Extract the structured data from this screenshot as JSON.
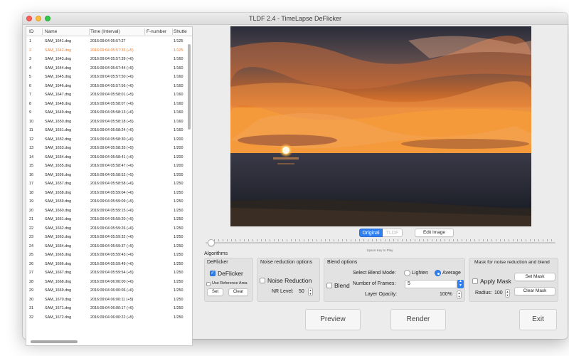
{
  "window": {
    "title": "TLDF 2.4 - TimeLapse DeFlicker"
  },
  "table": {
    "columns": [
      "ID",
      "Name",
      "Time (Interval)",
      "F-number",
      "Shutte"
    ],
    "rows": [
      {
        "id": "1",
        "name": "SAM_1641.dng",
        "time": "2016:09:04 05:57:27",
        "f": "",
        "shutter": "1/125"
      },
      {
        "id": "2",
        "name": "SAM_1642.dng",
        "time": "2016:09:04 05:57:33 (+5)",
        "f": "",
        "shutter": "1/125"
      },
      {
        "id": "3",
        "name": "SAM_1643.dng",
        "time": "2016:09:04 05:57:39 (+6)",
        "f": "",
        "shutter": "1/160"
      },
      {
        "id": "4",
        "name": "SAM_1644.dng",
        "time": "2016:09:04 05:57:44 (+5)",
        "f": "",
        "shutter": "1/160"
      },
      {
        "id": "5",
        "name": "SAM_1645.dng",
        "time": "2016:09:04 05:57:50 (+6)",
        "f": "",
        "shutter": "1/160"
      },
      {
        "id": "6",
        "name": "SAM_1646.dng",
        "time": "2016:09:04 05:57:56 (+6)",
        "f": "",
        "shutter": "1/160"
      },
      {
        "id": "7",
        "name": "SAM_1647.dng",
        "time": "2016:09:04 05:58:01 (+5)",
        "f": "",
        "shutter": "1/160"
      },
      {
        "id": "8",
        "name": "SAM_1648.dng",
        "time": "2016:09:04 05:58:07 (+6)",
        "f": "",
        "shutter": "1/160"
      },
      {
        "id": "9",
        "name": "SAM_1649.dng",
        "time": "2016:09:04 05:58:13 (+6)",
        "f": "",
        "shutter": "1/160"
      },
      {
        "id": "10",
        "name": "SAM_1650.dng",
        "time": "2016:09:04 05:58:18 (+5)",
        "f": "",
        "shutter": "1/160"
      },
      {
        "id": "11",
        "name": "SAM_1651.dng",
        "time": "2016:09:04 05:58:24 (+6)",
        "f": "",
        "shutter": "1/160"
      },
      {
        "id": "12",
        "name": "SAM_1652.dng",
        "time": "2016:09:04 05:58:30 (+6)",
        "f": "",
        "shutter": "1/200"
      },
      {
        "id": "13",
        "name": "SAM_1653.dng",
        "time": "2016:09:04 05:58:35 (+5)",
        "f": "",
        "shutter": "1/200"
      },
      {
        "id": "14",
        "name": "SAM_1654.dng",
        "time": "2016:09:04 05:58:41 (+6)",
        "f": "",
        "shutter": "1/200"
      },
      {
        "id": "15",
        "name": "SAM_1655.dng",
        "time": "2016:09:04 05:58:47 (+6)",
        "f": "",
        "shutter": "1/200"
      },
      {
        "id": "16",
        "name": "SAM_1656.dng",
        "time": "2016:09:04 05:58:52 (+5)",
        "f": "",
        "shutter": "1/200"
      },
      {
        "id": "17",
        "name": "SAM_1657.dng",
        "time": "2016:09:04 05:58:58 (+6)",
        "f": "",
        "shutter": "1/250"
      },
      {
        "id": "18",
        "name": "SAM_1658.dng",
        "time": "2016:09:04 05:59:04 (+6)",
        "f": "",
        "shutter": "1/250"
      },
      {
        "id": "19",
        "name": "SAM_1659.dng",
        "time": "2016:09:04 05:59:09 (+5)",
        "f": "",
        "shutter": "1/250"
      },
      {
        "id": "20",
        "name": "SAM_1660.dng",
        "time": "2016:09:04 05:59:15 (+6)",
        "f": "",
        "shutter": "1/250"
      },
      {
        "id": "21",
        "name": "SAM_1661.dng",
        "time": "2016:09:04 05:59:20 (+5)",
        "f": "",
        "shutter": "1/250"
      },
      {
        "id": "22",
        "name": "SAM_1662.dng",
        "time": "2016:09:04 05:59:26 (+6)",
        "f": "",
        "shutter": "1/250"
      },
      {
        "id": "23",
        "name": "SAM_1663.dng",
        "time": "2016:09:04 05:59:32 (+6)",
        "f": "",
        "shutter": "1/250"
      },
      {
        "id": "24",
        "name": "SAM_1664.dng",
        "time": "2016:09:04 05:59:37 (+5)",
        "f": "",
        "shutter": "1/250"
      },
      {
        "id": "25",
        "name": "SAM_1665.dng",
        "time": "2016:09:04 05:59:43 (+6)",
        "f": "",
        "shutter": "1/250"
      },
      {
        "id": "26",
        "name": "SAM_1666.dng",
        "time": "2016:09:04 05:59:49 (+6)",
        "f": "",
        "shutter": "1/250"
      },
      {
        "id": "27",
        "name": "SAM_1667.dng",
        "time": "2016:09:04 05:59:54 (+5)",
        "f": "",
        "shutter": "1/250"
      },
      {
        "id": "28",
        "name": "SAM_1668.dng",
        "time": "2016:09:04 06:00:00 (+6)",
        "f": "",
        "shutter": "1/250"
      },
      {
        "id": "29",
        "name": "SAM_1669.dng",
        "time": "2016:09:04 06:00:06 (+6)",
        "f": "",
        "shutter": "1/250"
      },
      {
        "id": "30",
        "name": "SAM_1670.dng",
        "time": "2016:09:04 06:00:11 (+5)",
        "f": "",
        "shutter": "1/250"
      },
      {
        "id": "31",
        "name": "SAM_1671.dng",
        "time": "2016:09:04 06:00:17 (+6)",
        "f": "",
        "shutter": "1/250"
      },
      {
        "id": "32",
        "name": "SAM_1672.dng",
        "time": "2016:09:04 06:00:22 (+5)",
        "f": "",
        "shutter": "1/250"
      }
    ],
    "selected_index": 1,
    "selected_color": "#f07a2c"
  },
  "preview": {
    "tabs": [
      "Original",
      "TLDF"
    ],
    "active_tab": "Original",
    "edit_button": "Edit Image",
    "hint": "Space Key to Play",
    "image_icon": "sunset-photo"
  },
  "algorithms": {
    "heading": "Algorithms",
    "deflicker": {
      "title": "DeFlicker",
      "checkbox_label": "DeFlicker",
      "checked": true,
      "ref_label": "Use Reference Area",
      "ref_checked": false,
      "set_button": "Set",
      "clear_button": "Clear"
    },
    "noise": {
      "title": "Noise reduction options",
      "checkbox_label": "Noise Reduction",
      "checked": false,
      "nr_label": "NR Level:",
      "nr_value": "50"
    },
    "blend": {
      "title": "Blend options",
      "checkbox_label": "Blend",
      "checked": false,
      "mode_label": "Select Blend Mode:",
      "mode_options": [
        "Lighten",
        "Average"
      ],
      "mode_selected": "Average",
      "frames_label": "Number of Frames:",
      "frames_value": "5",
      "opacity_label": "Layer Opacity:",
      "opacity_value": "100%"
    },
    "mask": {
      "title": "Mask for noise reduction and blend",
      "checkbox_label": "Apply Mask",
      "checked": false,
      "set_button": "Set Mask",
      "clear_button": "Clear Mask",
      "radius_label": "Radius:",
      "radius_value": "100"
    }
  },
  "actions": {
    "preview": "Preview",
    "render": "Render",
    "exit": "Exit"
  },
  "colors": {
    "accent": "#2f7ff1",
    "selected_row": "#f07a2c"
  }
}
